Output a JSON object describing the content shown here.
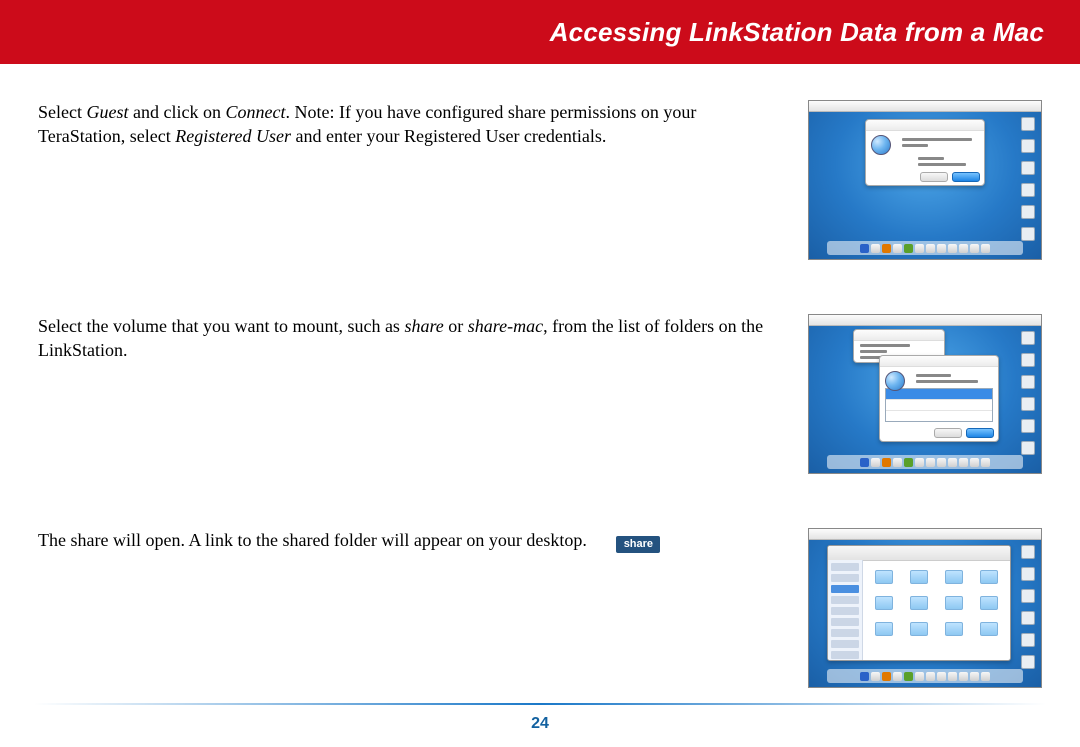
{
  "title": "Accessing LinkStation Data from a Mac",
  "page_number": "24",
  "paragraphs": {
    "p1": {
      "pre": "Select ",
      "em1": "Guest",
      "mid1": " and click on ",
      "em2": "Connect",
      "mid2": ".  Note:  If you have configured share permissions on your TeraStation, select ",
      "em3": "Registered User",
      "post": " and enter your Registered User credentials."
    },
    "p2": {
      "pre": "Select the volume that you want to mount, such as ",
      "em1": "share",
      "mid1": " or ",
      "em2": "share-mac",
      "post": ", from the list of folders on the LinkStation."
    },
    "p3": {
      "text": "The share will open.  A link to the shared folder will appear on your desktop."
    }
  },
  "share_icon_label": "share"
}
